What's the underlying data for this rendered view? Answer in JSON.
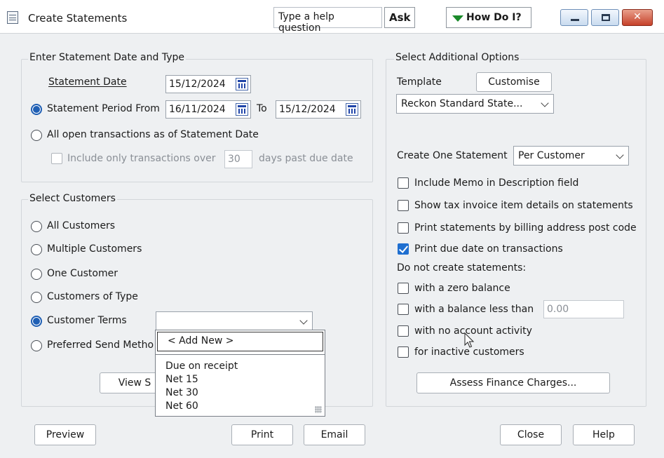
{
  "window": {
    "title": "Create Statements",
    "help_placeholder": "Type a help question",
    "ask_label": "Ask",
    "howdoi_label": "How Do I?"
  },
  "date_type": {
    "group_title": "Enter Statement Date and Type",
    "statement_date_label": "Statement Date",
    "statement_date_value": "15/12/2024",
    "period_from_label": "Statement Period From",
    "period_from_value": "16/11/2024",
    "to_label": "To",
    "period_to_value": "15/12/2024",
    "all_open_label": "All open transactions as of Statement Date",
    "include_only_label": "Include only transactions over",
    "days_value": "30",
    "days_past_due_label": "days past due date"
  },
  "customers": {
    "group_title": "Select Customers",
    "all_label": "All Customers",
    "multiple_label": "Multiple Customers",
    "one_label": "One Customer",
    "of_type_label": "Customers of Type",
    "terms_label": "Customer Terms",
    "terms_value": "",
    "preferred_label": "Preferred Send Metho",
    "view_btn_label": "View S"
  },
  "terms_dropdown": {
    "add_new": "< Add New >",
    "items": [
      "Due on receipt",
      "Net 15",
      "Net 30",
      "Net 60"
    ]
  },
  "options": {
    "group_title": "Select Additional Options",
    "template_label": "Template",
    "customise_label": "Customise",
    "template_value": "Reckon Standard State...",
    "create_one_label": "Create One Statement",
    "create_one_value": "Per Customer",
    "memo_label": "Include Memo in Description field",
    "tax_label": "Show tax invoice item details on statements",
    "billing_label": "Print statements by billing address post code",
    "due_date_label": "Print due date on transactions",
    "do_not_label": "Do not create statements:",
    "zero_label": "with a zero balance",
    "less_than_label": "with a balance less than",
    "less_than_value": "0.00",
    "no_activity_label": "with no account activity",
    "inactive_label": "for inactive customers",
    "finance_label": "Assess Finance Charges..."
  },
  "footer": {
    "preview": "Preview",
    "print": "Print",
    "email": "Email",
    "close": "Close",
    "help": "Help"
  },
  "colors": {
    "accent": "#1f6fd0",
    "howdoi_arrow": "#1a8a2a",
    "close_button": "#c6412a"
  }
}
